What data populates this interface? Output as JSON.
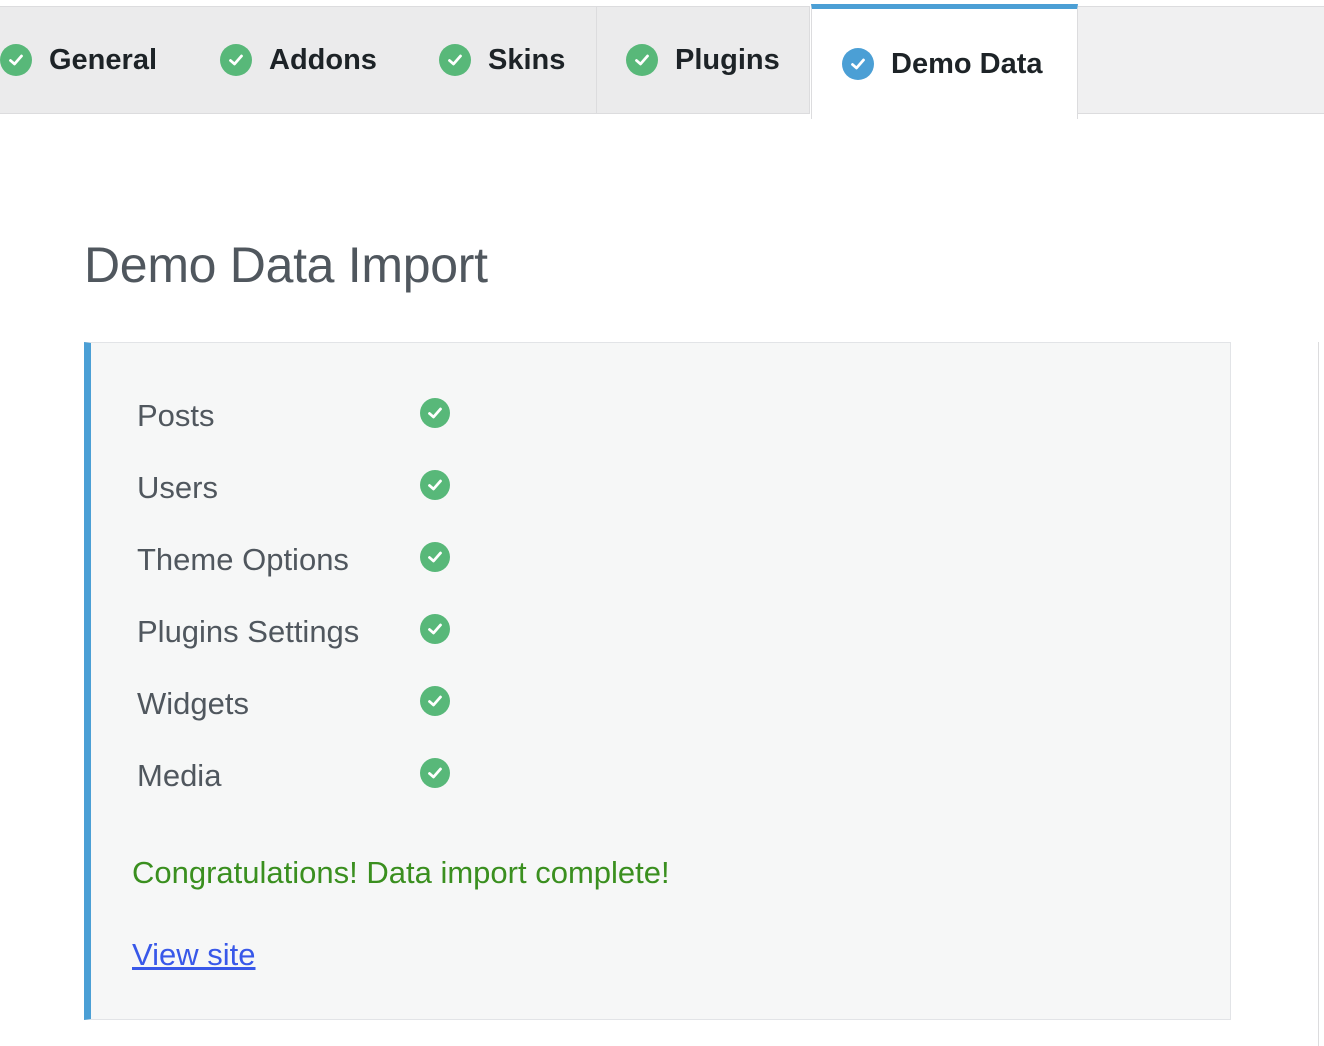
{
  "tabs": [
    {
      "label": "General",
      "status": "complete"
    },
    {
      "label": "Addons",
      "status": "complete"
    },
    {
      "label": "Skins",
      "status": "complete"
    },
    {
      "label": "Plugins",
      "status": "complete"
    },
    {
      "label": "Demo Data",
      "status": "active"
    }
  ],
  "main": {
    "title": "Demo Data Import",
    "import_items": [
      {
        "label": "Posts",
        "status": "done"
      },
      {
        "label": "Users",
        "status": "done"
      },
      {
        "label": "Theme Options",
        "status": "done"
      },
      {
        "label": "Plugins Settings",
        "status": "done"
      },
      {
        "label": "Widgets",
        "status": "done"
      },
      {
        "label": "Media",
        "status": "done"
      }
    ],
    "success_message": "Congratulations! Data import complete!",
    "view_site_link": "View site"
  },
  "colors": {
    "complete_green": "#58b879",
    "active_blue": "#4b9fd5",
    "success_text": "#3a8f1f",
    "link": "#3858e9"
  },
  "icons": {
    "tab_complete": "check-circle-icon",
    "tab_active": "check-circle-icon",
    "item_done": "check-circle-icon"
  }
}
